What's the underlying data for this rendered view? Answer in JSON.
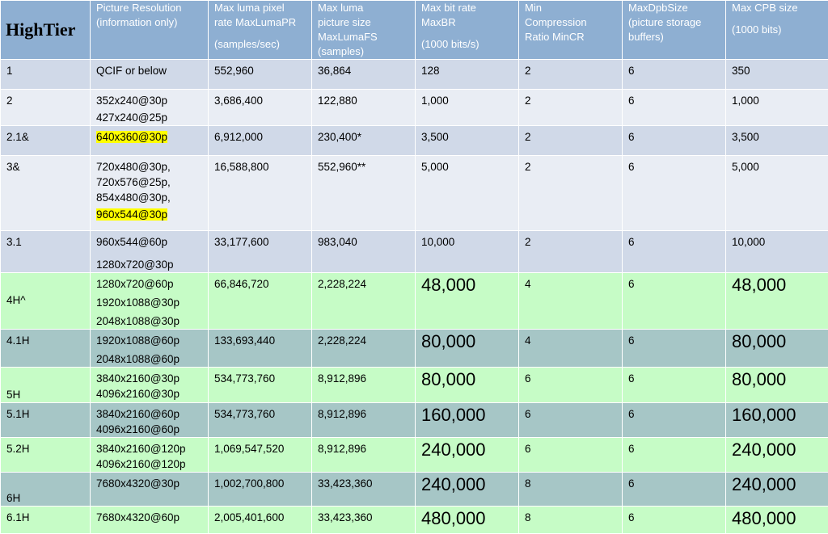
{
  "headers": {
    "tier": "HighTier",
    "resolution": [
      "Picture    Resolution",
      "(information only)"
    ],
    "max_luma_pr": [
      "Max luma pixel",
      "rate MaxLumaPR",
      "",
      "(samples/sec)"
    ],
    "max_luma_fs": [
      "Max luma",
      "picture size",
      "MaxLumaFS",
      "(samples)"
    ],
    "max_br": [
      "Max bit rate",
      "MaxBR",
      "",
      "(1000 bits/s)"
    ],
    "min_cr": [
      "Min",
      "Compression",
      "Ratio MinCR"
    ],
    "max_dpb": [
      "MaxDpbSize",
      "(picture storage",
      "buffers)"
    ],
    "max_cpb": [
      "Max CPB size",
      "",
      "(1000 bits)"
    ]
  },
  "rows": [
    {
      "level": "1",
      "res": [
        "QCIF or below"
      ],
      "pr": "552,960",
      "fs": "36,864",
      "br": "128",
      "cr": "2",
      "dpb": "6",
      "cpb": "350"
    },
    {
      "level": "2",
      "res": [
        "352x240@30p",
        "427x240@25p"
      ],
      "pr": "3,686,400",
      "fs": "122,880",
      "br": "1,000",
      "cr": "2",
      "dpb": "6",
      "cpb": "1,000"
    },
    {
      "level": "2.1&",
      "res": [
        "640x360@30p"
      ],
      "pr": "6,912,000",
      "fs": "230,400*",
      "br": "3,500",
      "cr": "2",
      "dpb": "6",
      "cpb": "3,500"
    },
    {
      "level": "3&",
      "res": [
        "720x480@30p,",
        "720x576@25p,",
        "854x480@30p,",
        "960x544@30p"
      ],
      "pr": "16,588,800",
      "fs": "552,960**",
      "br": "5,000",
      "cr": "2",
      "dpb": "6",
      "cpb": "5,000"
    },
    {
      "level": "3.1",
      "res": [
        "960x544@60p",
        "1280x720@30p"
      ],
      "pr": "33,177,600",
      "fs": "983,040",
      "br": "10,000",
      "cr": "2",
      "dpb": "6",
      "cpb": "10,000"
    },
    {
      "level": "4H^",
      "res": [
        "1280x720@60p",
        "1920x1088@30p",
        "2048x1088@30p"
      ],
      "pr": "66,846,720",
      "fs": "2,228,224",
      "br": "48,000",
      "cr": "4",
      "dpb": "6",
      "cpb": "48,000"
    },
    {
      "level": "4.1H",
      "res": [
        "1920x1088@60p",
        "2048x1088@60p"
      ],
      "pr": "133,693,440",
      "fs": "2,228,224",
      "br": "80,000",
      "cr": "4",
      "dpb": "6",
      "cpb": "80,000"
    },
    {
      "level": "5H",
      "res": [
        "3840x2160@30p",
        "4096x2160@30p"
      ],
      "pr": "534,773,760",
      "fs": "8,912,896",
      "br": "80,000",
      "cr": "6",
      "dpb": "6",
      "cpb": "80,000"
    },
    {
      "level": "5.1H",
      "res": [
        "3840x2160@60p",
        "4096x2160@60p"
      ],
      "pr": "534,773,760",
      "fs": "8,912,896",
      "br": "160,000",
      "cr": "6",
      "dpb": "6",
      "cpb": "160,000"
    },
    {
      "level": "5.2H",
      "res": [
        "3840x2160@120p",
        "4096x2160@120p"
      ],
      "pr": "1,069,547,520",
      "fs": "8,912,896",
      "br": "240,000",
      "cr": "6",
      "dpb": "6",
      "cpb": "240,000"
    },
    {
      "level": "6H",
      "res": [
        "7680x4320@30p"
      ],
      "pr": "1,002,700,800",
      "fs": "33,423,360",
      "br": "240,000",
      "cr": "8",
      "dpb": "6",
      "cpb": "240,000"
    },
    {
      "level": "6.1H",
      "res": [
        "7680x4320@60p"
      ],
      "pr": "2,005,401,600",
      "fs": "33,423,360",
      "br": "480,000",
      "cr": "8",
      "dpb": "6",
      "cpb": "480,000"
    }
  ],
  "highlight_color": "#ffff00"
}
